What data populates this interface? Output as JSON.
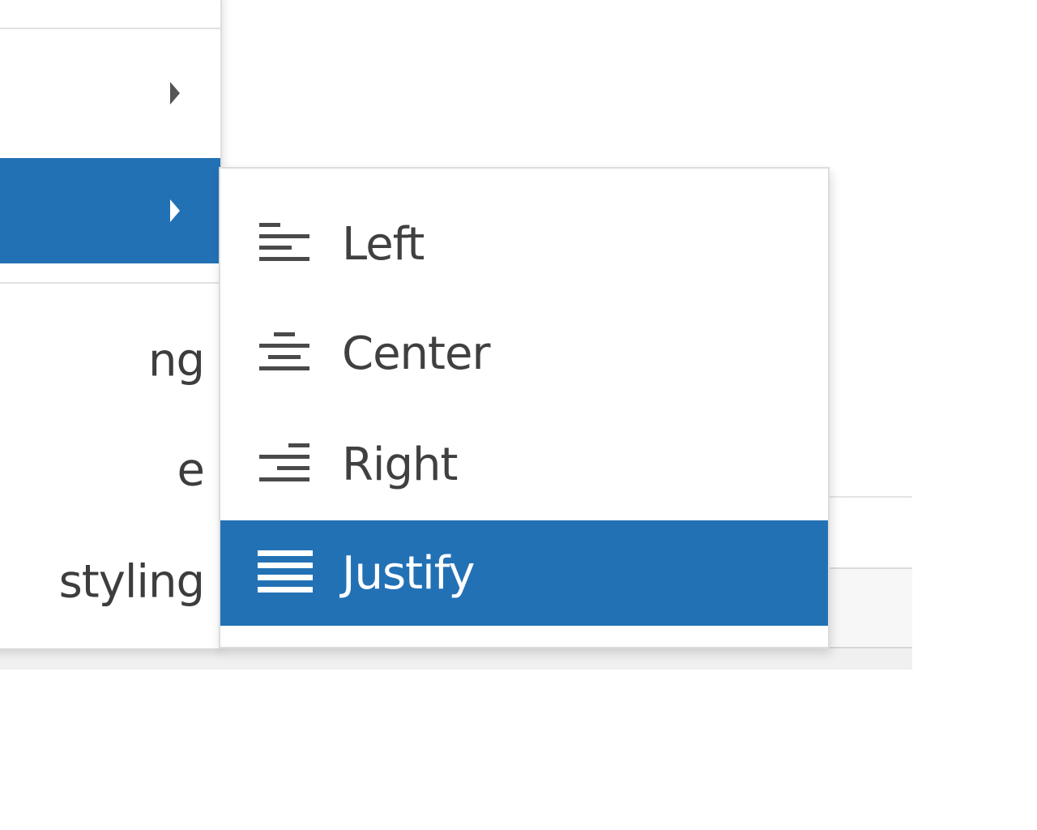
{
  "parent_menu": {
    "items": [
      {
        "label": "",
        "has_submenu": true,
        "active": false
      },
      {
        "label": "",
        "has_submenu": true,
        "active": true
      },
      {
        "label": "ng"
      },
      {
        "label": "e"
      },
      {
        "label": "styling"
      }
    ]
  },
  "submenu": {
    "items": [
      {
        "label": "Left",
        "icon": "align-left-icon",
        "selected": false
      },
      {
        "label": "Center",
        "icon": "align-center-icon",
        "selected": false
      },
      {
        "label": "Right",
        "icon": "align-right-icon",
        "selected": false
      },
      {
        "label": "Justify",
        "icon": "align-justify-icon",
        "selected": true
      }
    ]
  },
  "colors": {
    "highlight": "#2371b5",
    "icon": "#4a4a4a",
    "text": "#404040"
  }
}
